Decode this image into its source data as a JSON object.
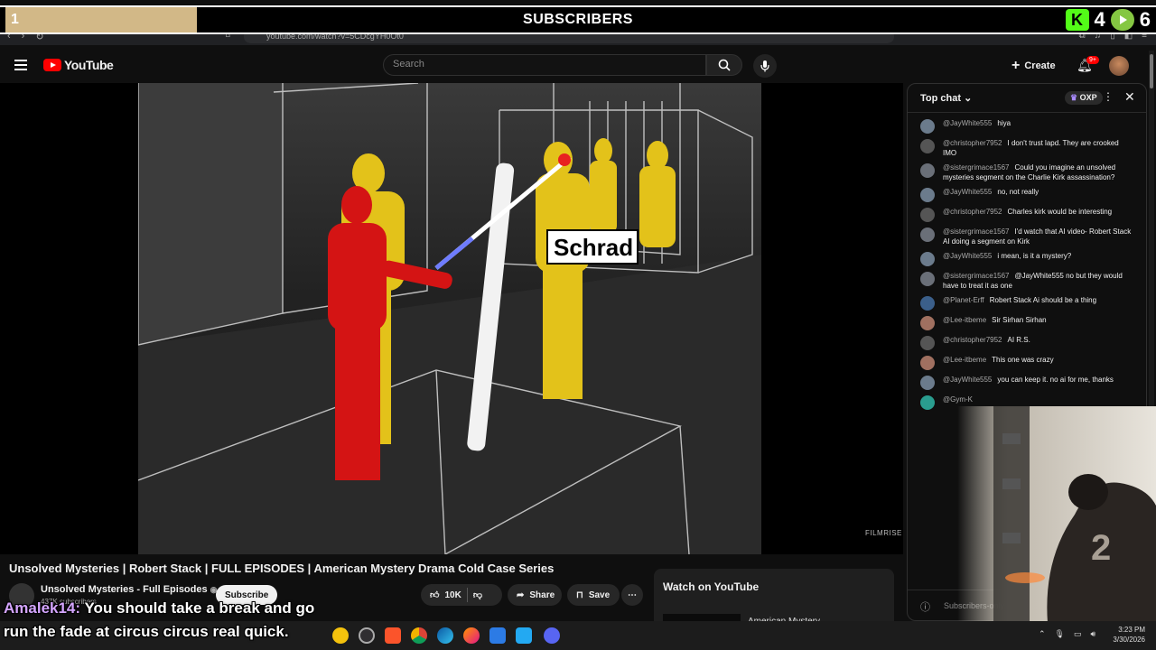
{
  "overlay": {
    "left_count": "1",
    "title": "SUBSCRIBERS",
    "kick_count": "4",
    "rumble_count": "6",
    "kick_icon": "kick-logo",
    "rumble_icon": "rumble-logo",
    "progress_color": "#d2b887"
  },
  "browser": {
    "url": "youtube.com/watch?v=5CDcgYH0Ot0"
  },
  "header": {
    "logo_text": "YouTube",
    "search_placeholder": "Search",
    "create_label": "Create",
    "notification_count": "9+"
  },
  "video": {
    "label_text": "Schrad",
    "watermark": "FILMRISE"
  },
  "below_video": {
    "title": "Unsolved Mysteries | Robert Stack | FULL EPISODES | American Mystery Drama Cold Case Series",
    "channel_name": "Unsolved Mysteries - Full Episodes",
    "subscriber_count": "437K subscribers",
    "subscribe_label": "Subscribe",
    "like_count": "10K",
    "share_label": "Share",
    "save_label": "Save"
  },
  "watch_card": {
    "title": "Watch on YouTube",
    "subtitle": "American Mystery"
  },
  "chat": {
    "header_label": "Top chat",
    "points_label": "OXP",
    "footer_text": "Subscribers-only m",
    "messages": [
      {
        "author": "@JayWhite555",
        "text": "hiya",
        "color": "#6b7b8c"
      },
      {
        "author": "@christopher7952",
        "text": "I don't trust lapd. They are crooked IMO",
        "color": "#555"
      },
      {
        "author": "@sistergrimace1567",
        "text": "Could you imagine an unsolved mysteries segment on the Charlie Kirk assassination?",
        "color": "#6a6f78"
      },
      {
        "author": "@JayWhite555",
        "text": "no, not really",
        "color": "#6b7b8c"
      },
      {
        "author": "@christopher7952",
        "text": "Charles kirk would be interesting",
        "color": "#555"
      },
      {
        "author": "@sistergrimace1567",
        "text": "I'd watch that AI video- Robert Stack AI doing a segment on Kirk",
        "color": "#6a6f78"
      },
      {
        "author": "@JayWhite555",
        "text": "i mean, is it a mystery?",
        "color": "#6b7b8c"
      },
      {
        "author": "@sistergrimace1567",
        "text": "@JayWhite555 no but they would have to treat it as one",
        "color": "#6a6f78"
      },
      {
        "author": "@Planet-Erff",
        "text": "Robert Stack Ai should be a thing",
        "color": "#3b5f8a"
      },
      {
        "author": "@Lee-itbeme",
        "text": "Sir Sirhan Sirhan",
        "color": "#a07060"
      },
      {
        "author": "@christopher7952",
        "text": "AI R.S.",
        "color": "#555"
      },
      {
        "author": "@Lee-itbeme",
        "text": "This one was crazy",
        "color": "#a07060"
      },
      {
        "author": "@JayWhite555",
        "text": "you can keep it. no ai for me, thanks",
        "color": "#6b7b8c"
      },
      {
        "author": "@Gym-K",
        "text": "",
        "color": "#2a9d8f"
      }
    ]
  },
  "captions": {
    "username": "Amalek14:",
    "line1": "You should take a break and go",
    "line2": "run the fade at circus circus real quick."
  },
  "taskbar": {
    "time": "3:23 PM",
    "date": "3/30/2026"
  }
}
